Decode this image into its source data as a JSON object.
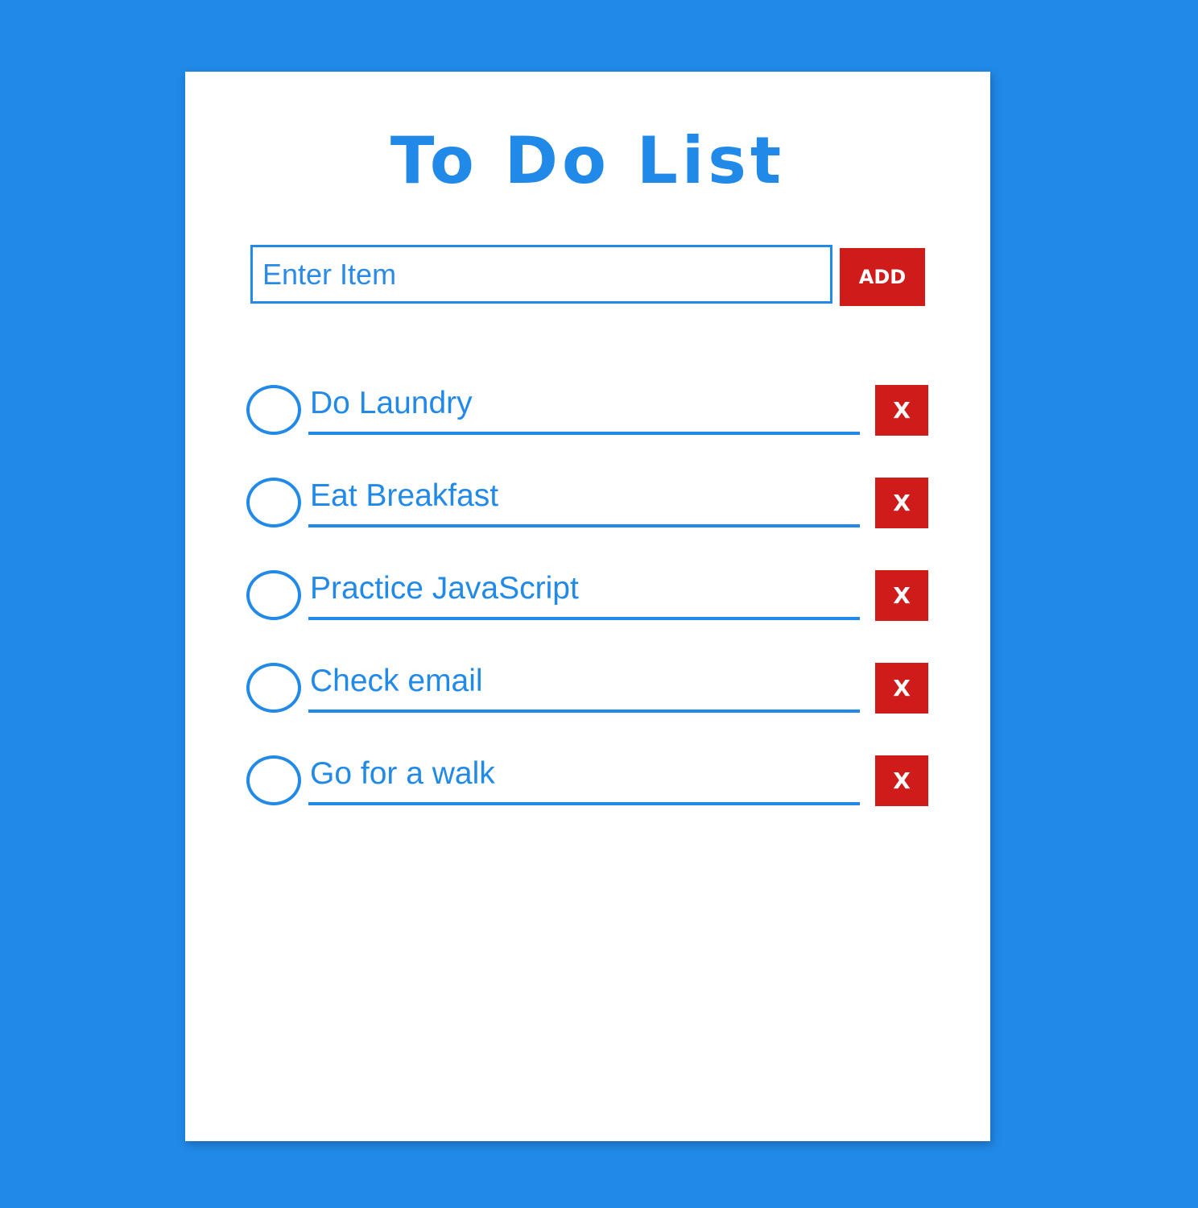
{
  "app": {
    "title": "To Do List"
  },
  "entry": {
    "placeholder": "Enter Item",
    "value": "",
    "add_label": "ADD"
  },
  "items": [
    {
      "label": "Do Laundry",
      "delete_label": "X"
    },
    {
      "label": "Eat Breakfast",
      "delete_label": "X"
    },
    {
      "label": "Practice JavaScript",
      "delete_label": "X"
    },
    {
      "label": "Check email",
      "delete_label": "X"
    },
    {
      "label": "Go for a walk",
      "delete_label": "X"
    }
  ],
  "colors": {
    "background": "#2189e8",
    "card": "#ffffff",
    "accent": "#2189e8",
    "danger": "#d01b1b"
  },
  "icons": {
    "checkbox": "circle-checkbox-icon"
  }
}
